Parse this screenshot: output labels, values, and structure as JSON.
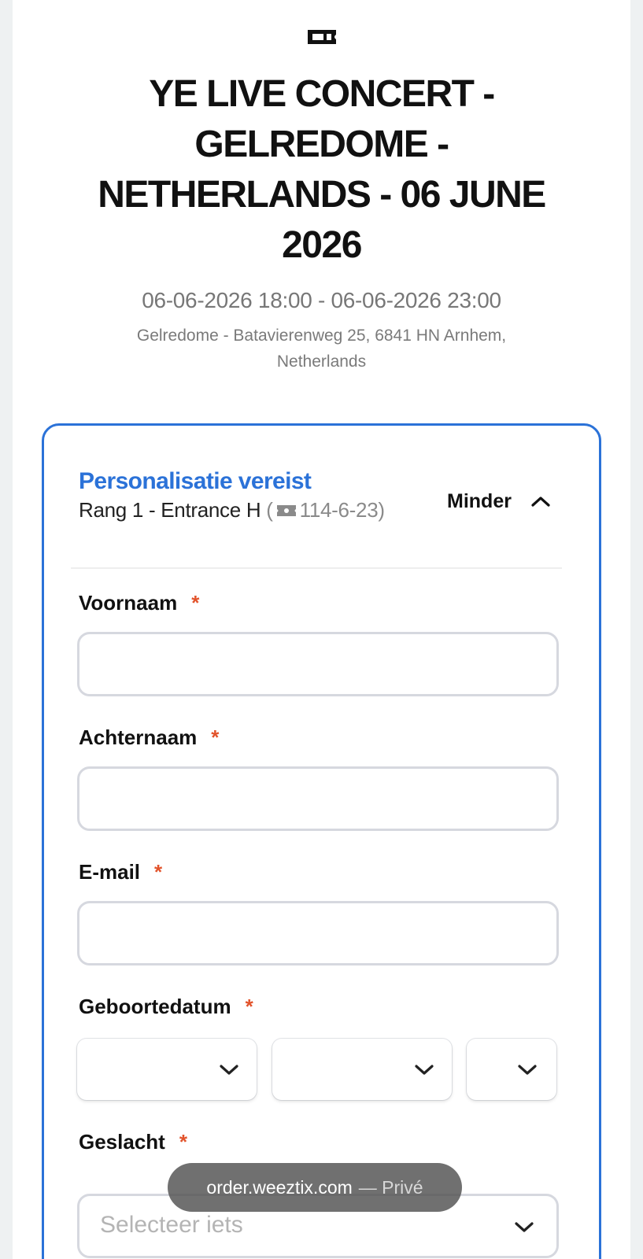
{
  "event": {
    "title": "YE LIVE CONCERT - GELREDOME - NETHERLANDS - 06 JUNE 2026",
    "datetime": "06-06-2026 18:00 - 06-06-2026 23:00",
    "venue": "Gelredome - Batavierenweg 25, 6841 HN Arnhem, Netherlands"
  },
  "ticket": {
    "heading": "Personalisatie vereist",
    "section": "Rang 1 - Entrance H",
    "open_paren": "(",
    "seat": "114-6-23",
    "close_paren": ")",
    "toggle_label": "Minder"
  },
  "form": {
    "required_mark": "*",
    "first_name_label": "Voornaam",
    "last_name_label": "Achternaam",
    "email_label": "E-mail",
    "birthdate_label": "Geboortedatum",
    "gender_label": "Geslacht",
    "gender_placeholder": "Selecteer iets",
    "first_name_value": "",
    "last_name_value": "",
    "email_value": ""
  },
  "browser": {
    "domain": "order.weeztix.com",
    "mode": "— Privé"
  },
  "colors": {
    "accent": "#2b72d8",
    "required": "#e2532b"
  }
}
